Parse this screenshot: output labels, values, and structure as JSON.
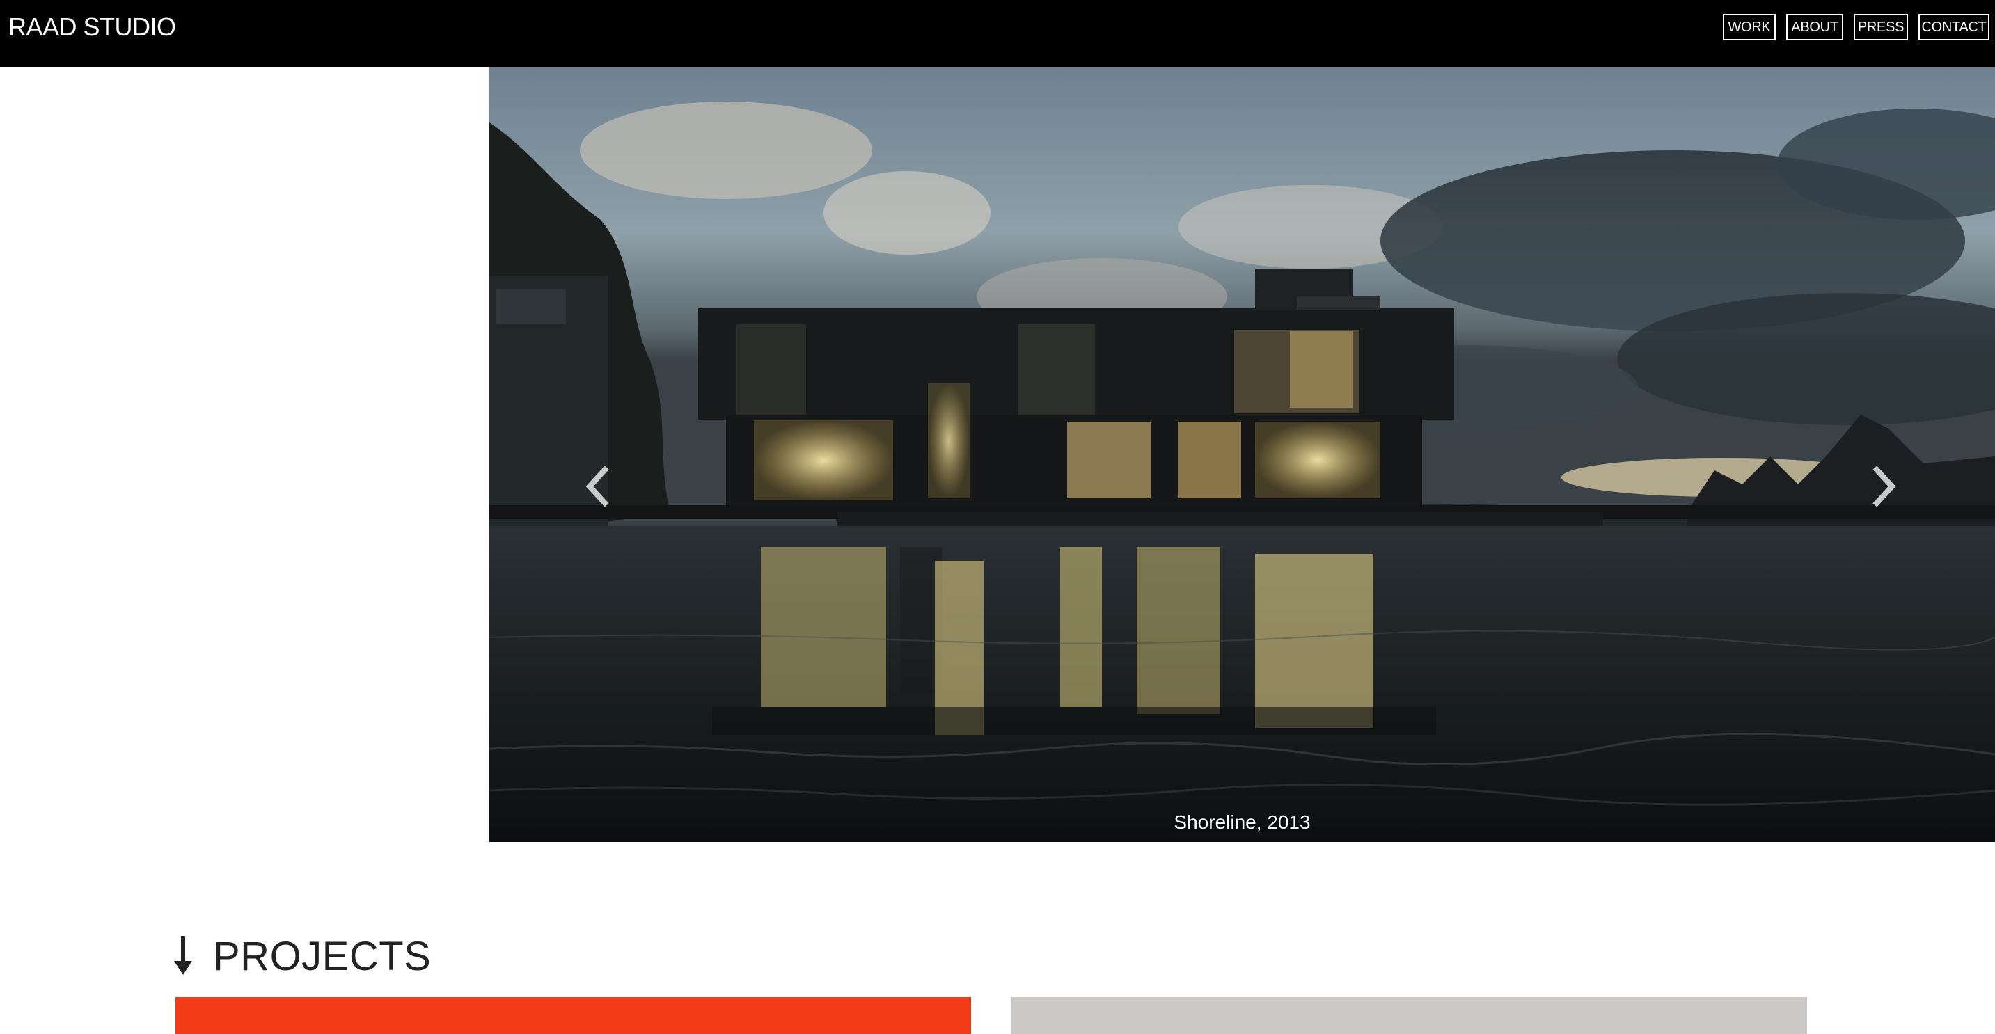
{
  "header": {
    "logo": "RAAD STUDIO",
    "nav": [
      "WORK",
      "ABOUT",
      "PRESS",
      "CONTACT"
    ]
  },
  "slider": {
    "caption": "Shoreline, 2013",
    "slide_count": 3,
    "active_slide": 2,
    "icons": {
      "prev": "chevron-left-icon",
      "next": "chevron-right-icon"
    }
  },
  "projects": {
    "heading": "PROJECTS",
    "icon": "arrow-down-icon",
    "cards": [
      {
        "color": "#f33b17"
      },
      {
        "color": "#cbc8c5"
      }
    ]
  },
  "colors": {
    "header_bg": "#000000",
    "accent": "#f33b17",
    "card_gray": "#cbc8c5",
    "text_dark": "#222222"
  }
}
